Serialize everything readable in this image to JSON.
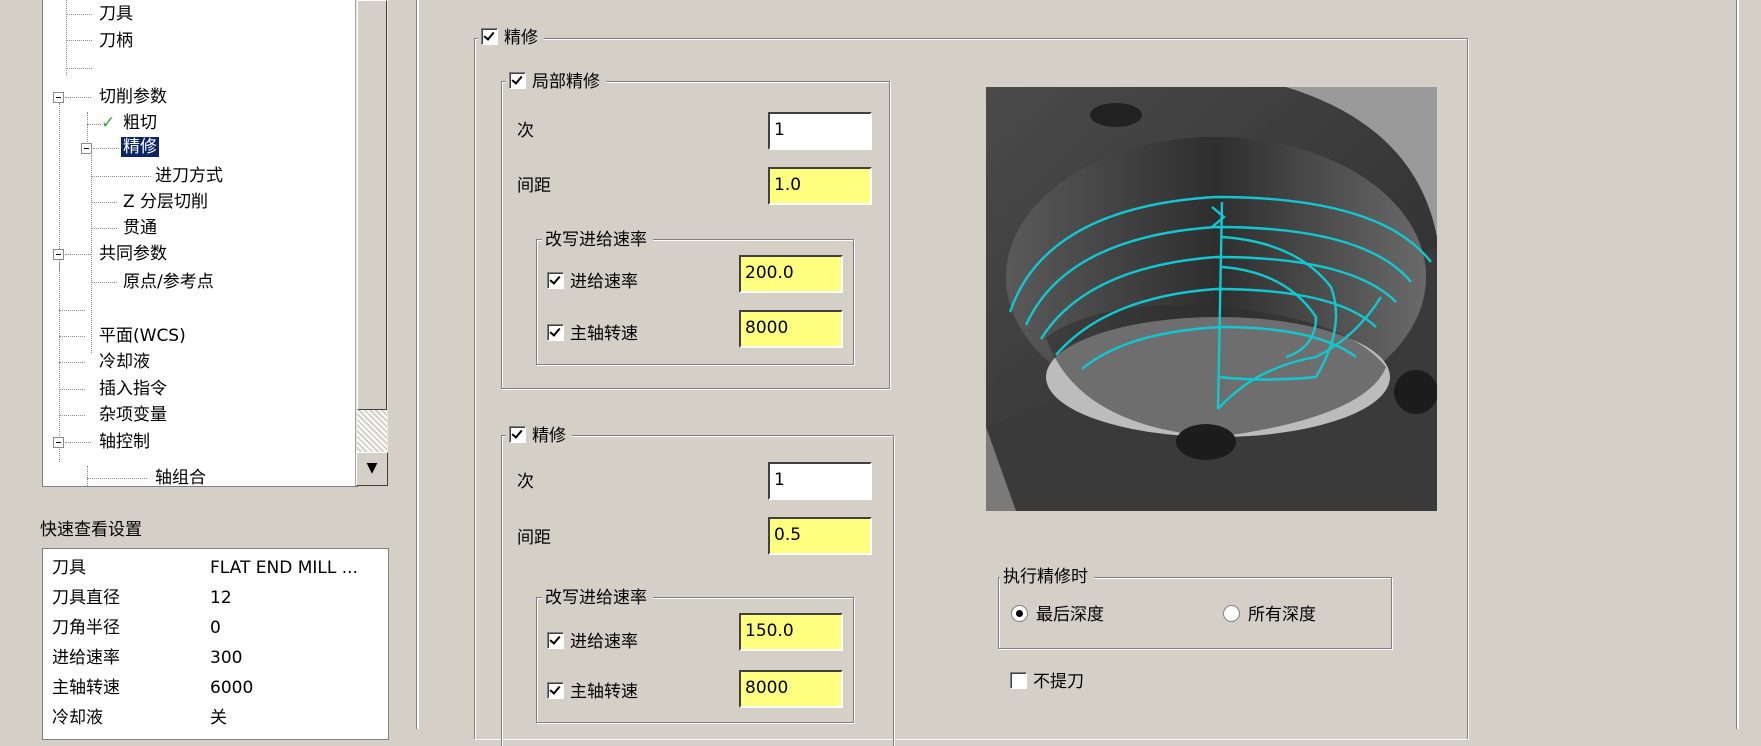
{
  "tree": {
    "items": [
      {
        "label": "刀具"
      },
      {
        "label": "刀柄"
      },
      {
        "label": "切削参数"
      },
      {
        "label": "粗切"
      },
      {
        "label": "精修"
      },
      {
        "label": "进刀方式"
      },
      {
        "label": "Z 分层切削"
      },
      {
        "label": "贯通"
      },
      {
        "label": "共同参数"
      },
      {
        "label": "原点/参考点"
      },
      {
        "label": "平面(WCS)"
      },
      {
        "label": "冷却液"
      },
      {
        "label": "插入指令"
      },
      {
        "label": "杂项变量"
      },
      {
        "label": "轴控制"
      },
      {
        "label": "轴组合"
      }
    ]
  },
  "quick_view": {
    "title": "快速查看设置",
    "rows": [
      {
        "key": "刀具",
        "value": "FLAT END MILL ..."
      },
      {
        "key": "刀具直径",
        "value": "12"
      },
      {
        "key": "刀角半径",
        "value": "0"
      },
      {
        "key": "进给速率",
        "value": "300"
      },
      {
        "key": "主轴转速",
        "value": "6000"
      },
      {
        "key": "冷却液",
        "value": "关"
      }
    ]
  },
  "finish": {
    "label": "精修",
    "checked": true,
    "partial": {
      "label": "局部精修",
      "passes_label": "次",
      "passes": "1",
      "step_label": "间距",
      "step": "1.0",
      "override": {
        "label": "改写进给速率",
        "feed_label": "进给速率",
        "feed": "200.0",
        "spindle_label": "主轴转速",
        "spindle": "8000"
      }
    },
    "final": {
      "label": "精修",
      "passes_label": "次",
      "passes": "1",
      "step_label": "间距",
      "step": "0.5",
      "override": {
        "label": "改写进给速率",
        "feed_label": "进给速率",
        "feed": "150.0",
        "spindle_label": "主轴转速",
        "spindle": "8000"
      }
    },
    "when": {
      "label": "执行精修时",
      "option_last": "最后深度",
      "option_all": "所有深度",
      "selected": "最后深度"
    },
    "no_retract_label": "不提刀"
  },
  "colors": {
    "background": "#d4d0c8",
    "field_highlight": "#ffff80",
    "selection": "#0a246a",
    "toolpath": "#00c8d0"
  }
}
